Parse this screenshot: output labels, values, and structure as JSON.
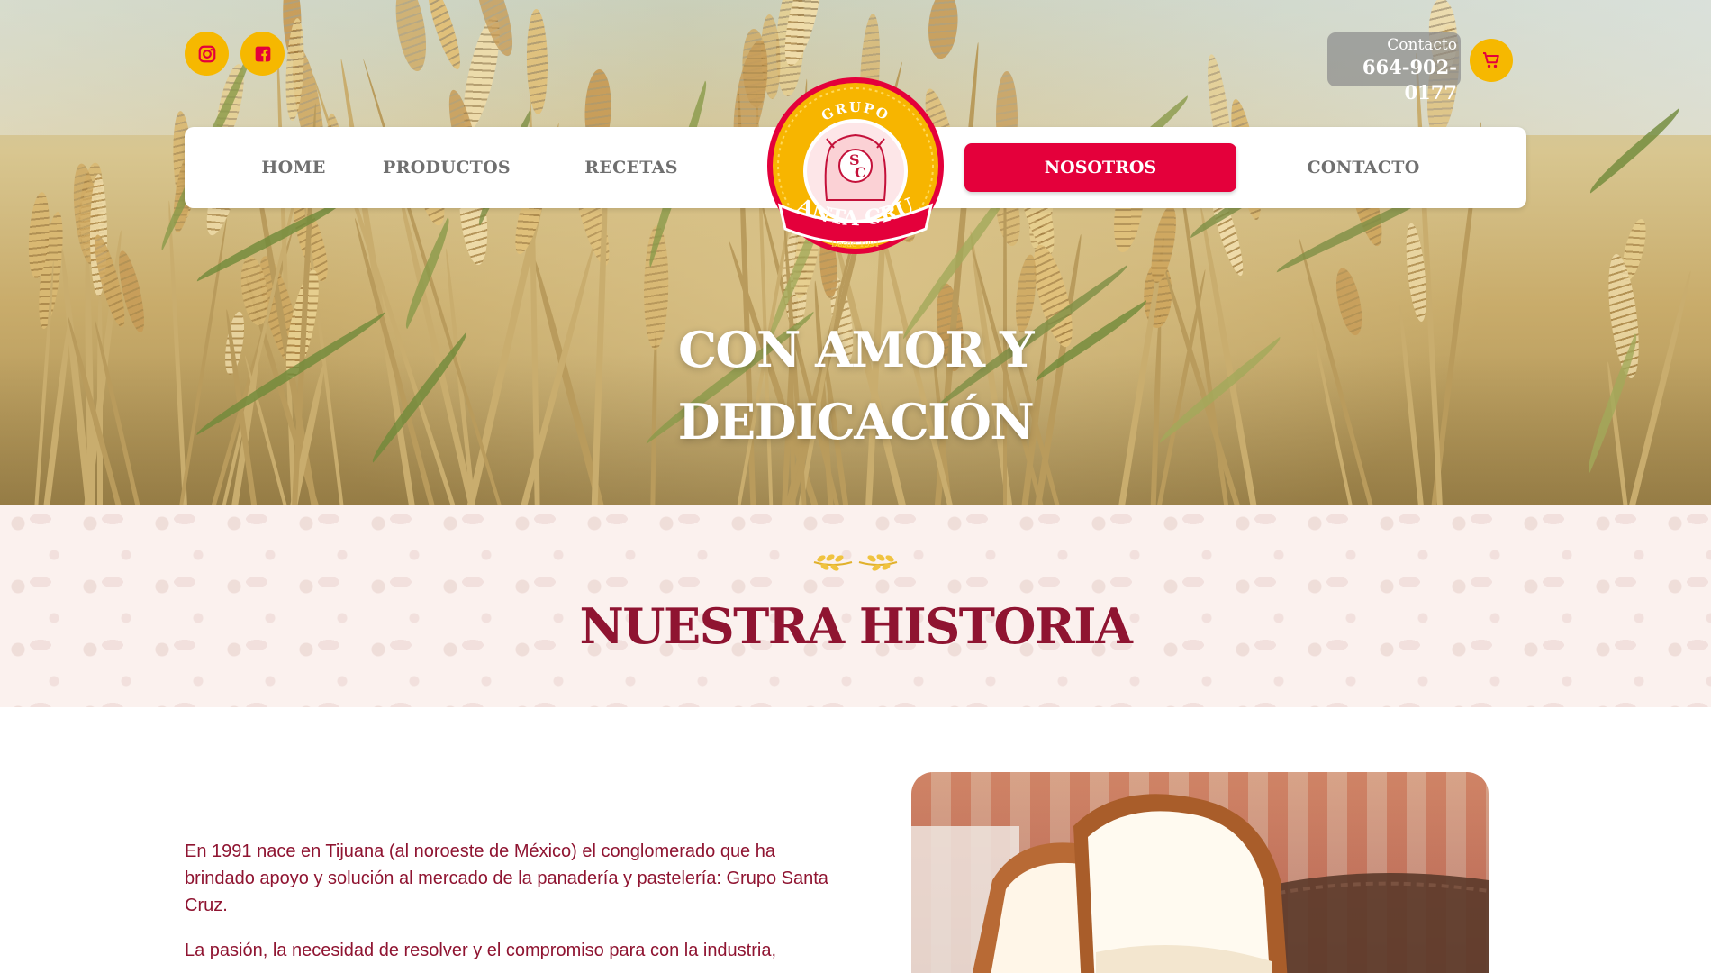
{
  "social": {
    "instagram_icon": "instagram-icon",
    "facebook_icon": "facebook-icon"
  },
  "contact": {
    "label": "Contacto",
    "phone": "664-902-0177"
  },
  "cart": {
    "icon": "cart-icon"
  },
  "nav": {
    "items": [
      "HOME",
      "PRODUCTOS",
      "RECETAS",
      "NOSOTROS",
      "CONTACTO"
    ],
    "active": "NOSOTROS"
  },
  "logo": {
    "top_text": "GRUPO",
    "monogram_s": "S",
    "monogram_c": "C",
    "brand": "SANTA CRUZ",
    "since": "Desde 1991"
  },
  "hero": {
    "line1": "CON AMOR Y",
    "line2": "DEDICACIÓN"
  },
  "history": {
    "title": "NUESTRA HISTORIA",
    "paragraph1": "En 1991 nace en Tijuana (al noroeste de México) el conglomerado que ha brindado apoyo y solución al mercado de la panadería y pastelería: Grupo Santa Cruz.",
    "paragraph2": "La pasión, la necesidad de resolver y el compromiso para con la industria,"
  },
  "colors": {
    "accent_red": "#e4003b",
    "maroon": "#8f1431",
    "gold": "#f6b800"
  }
}
